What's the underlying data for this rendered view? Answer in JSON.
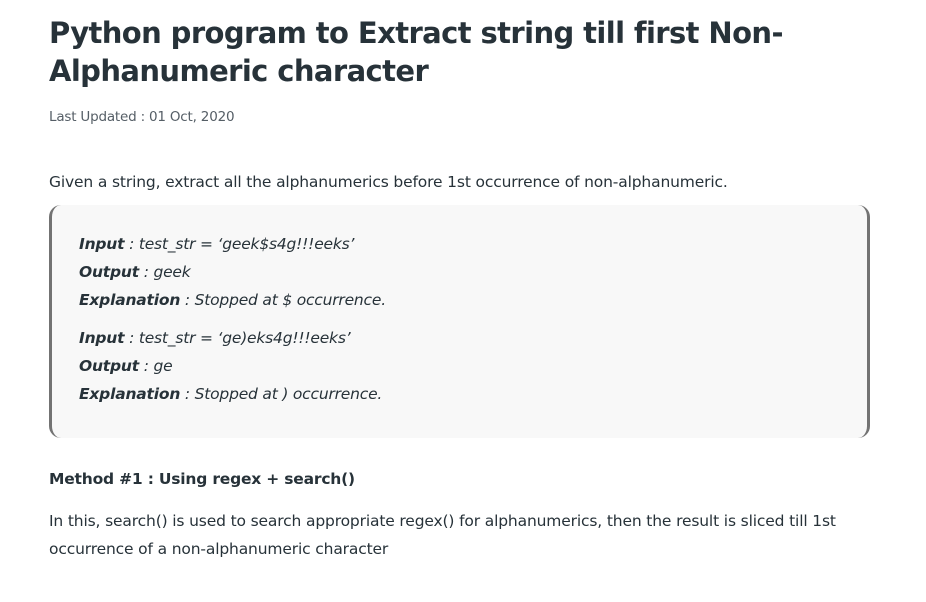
{
  "article": {
    "title": "Python program to Extract string till first Non-Alphanumeric character",
    "last_updated_label": "Last Updated : ",
    "last_updated_date": "01 Oct, 2020",
    "intro": "Given a string, extract all the alphanumerics before 1st occurrence of non-alphanumeric.",
    "examples": [
      {
        "input_key": "Input",
        "input_value": " : test_str = ‘geek$s4g!!!eeks’",
        "output_key": "Output",
        "output_value": " : geek",
        "explanation_key": "Explanation",
        "explanation_value": " : Stopped at $ occurrence."
      },
      {
        "input_key": "Input",
        "input_value": " : test_str = ‘ge)eks4g!!!eeks’",
        "output_key": "Output",
        "output_value": " : ge",
        "explanation_key": "Explanation",
        "explanation_value": " : Stopped at ) occurrence."
      }
    ],
    "method_heading": "Method #1 : Using regex + search()",
    "method_description": "In this, search() is used to search appropriate regex() for alphanumerics, then the result is sliced till 1st occurrence of a non-alphanumeric character"
  }
}
